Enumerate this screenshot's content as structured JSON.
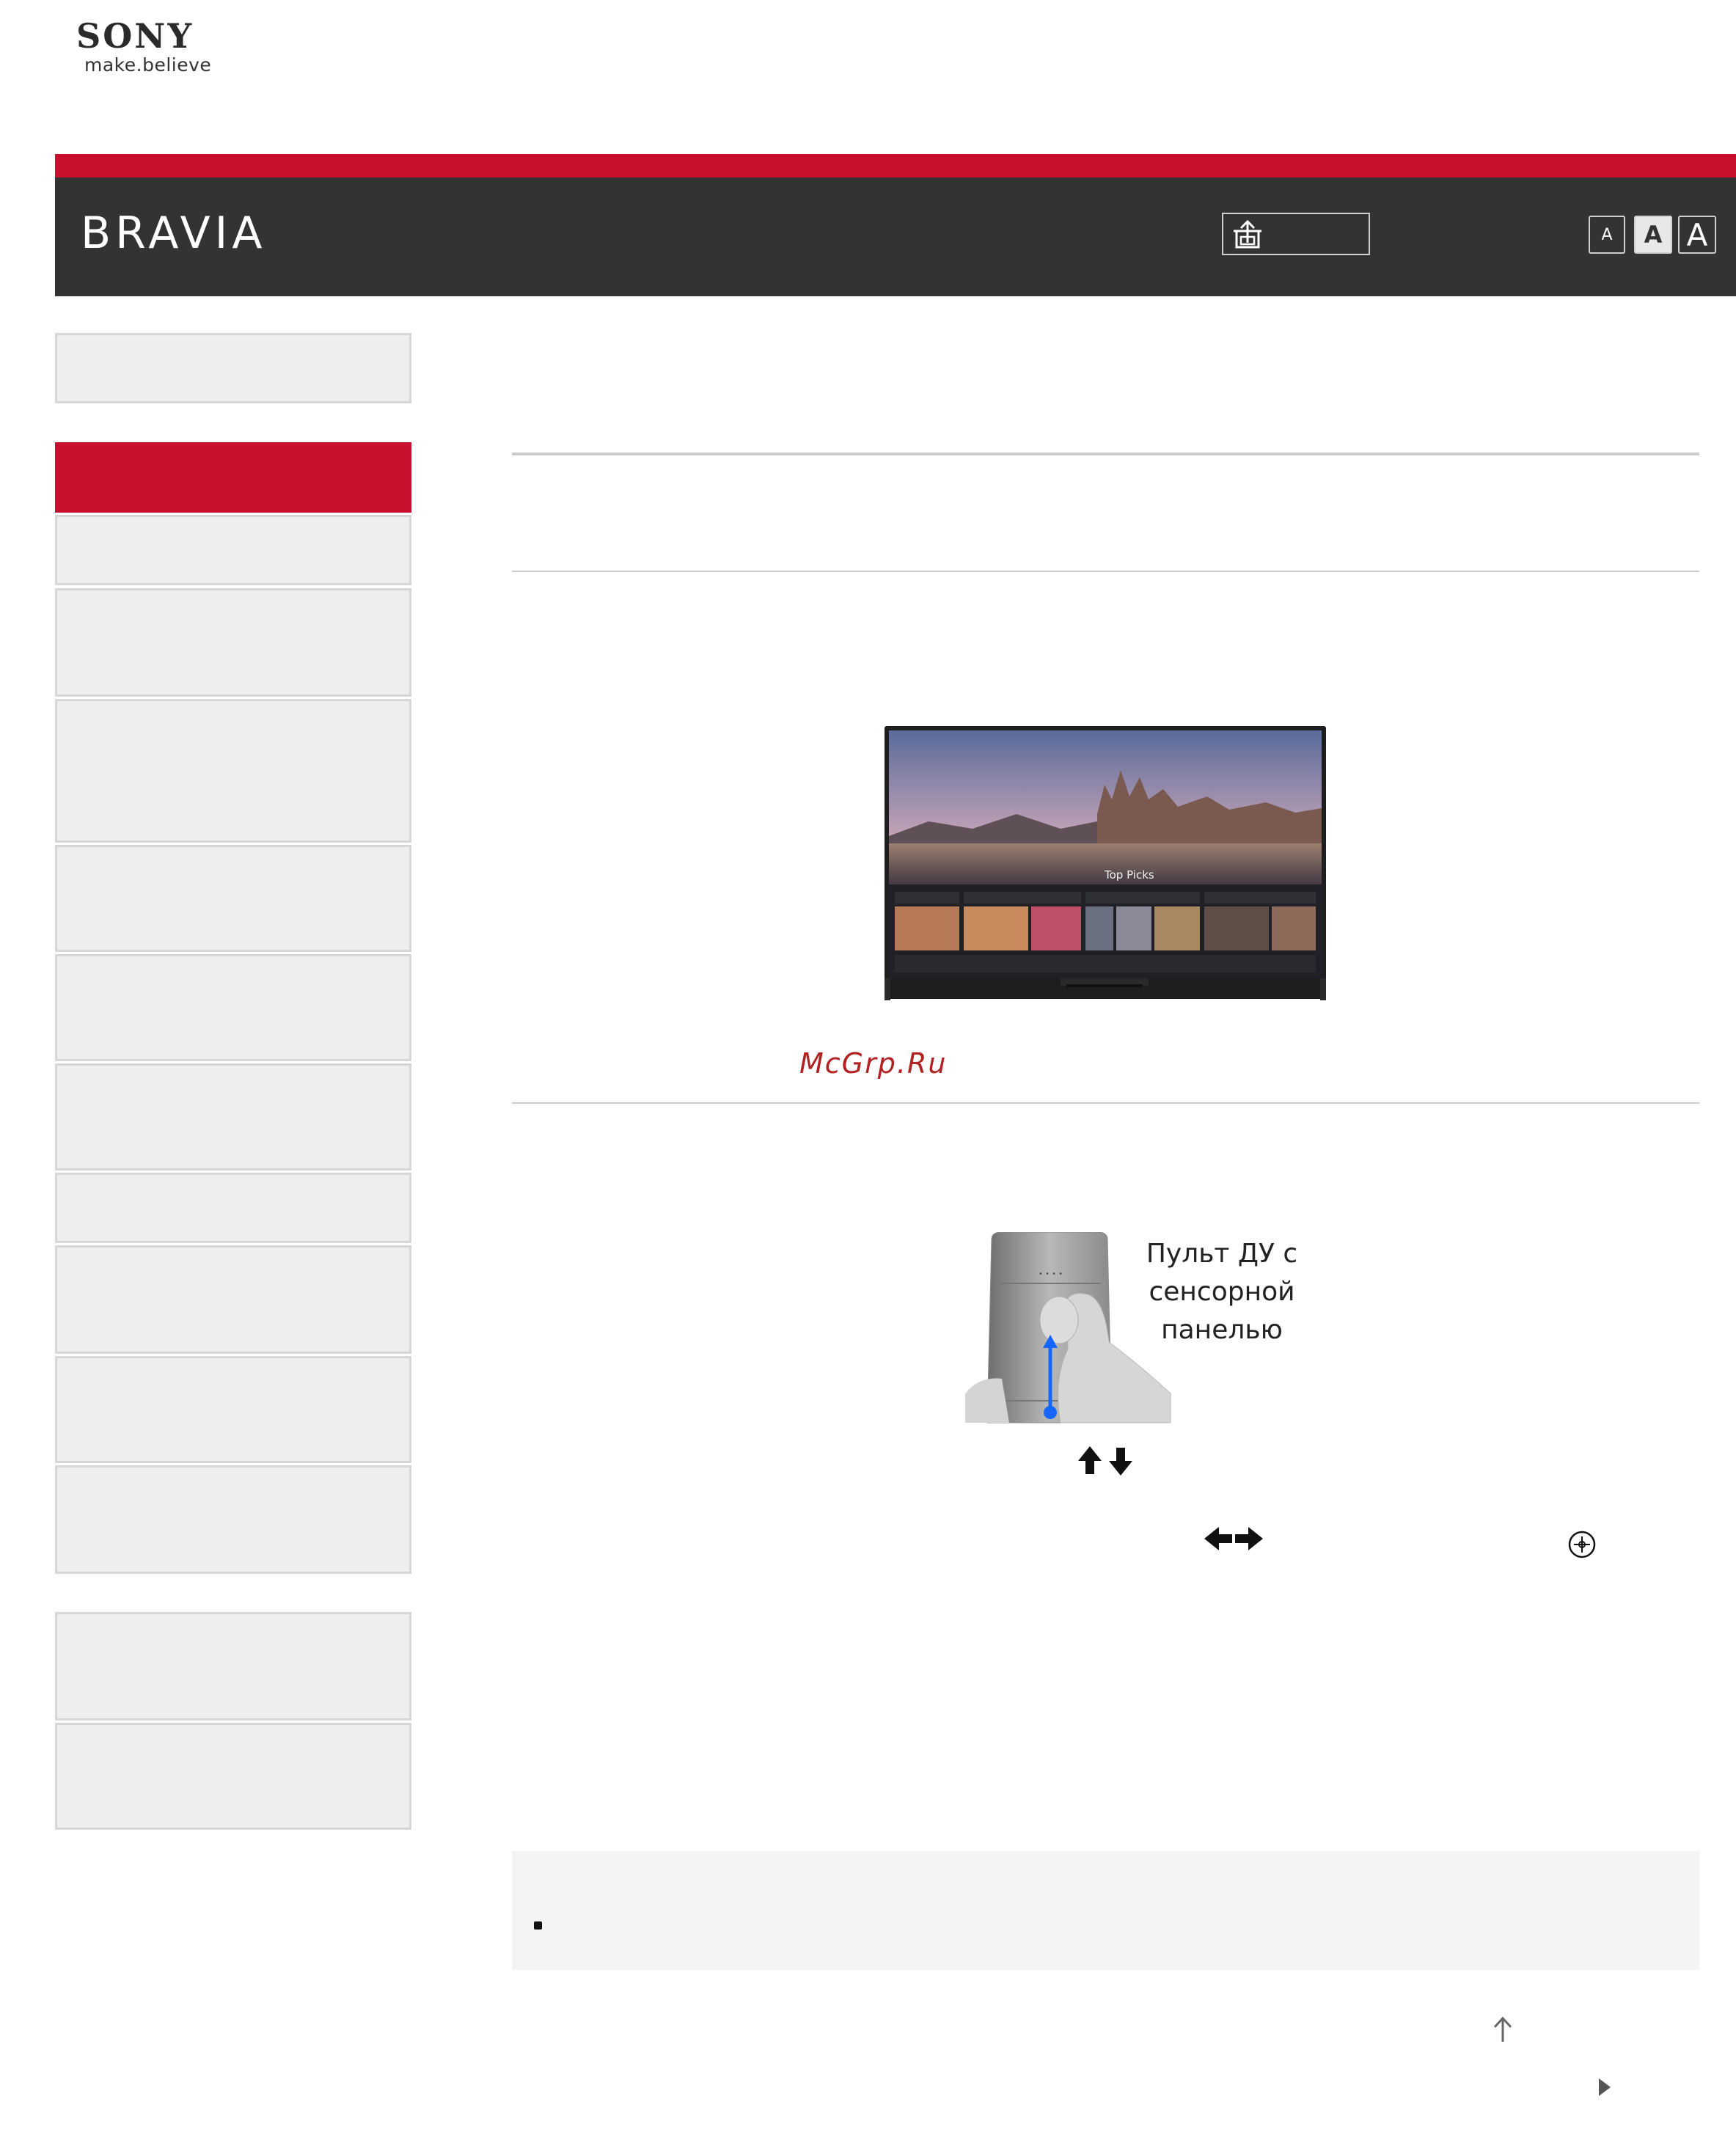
{
  "brand": {
    "name": "SONY",
    "tagline": "make.believe"
  },
  "header": {
    "title": "BRAVIA",
    "font_size_buttons": [
      "A",
      "A",
      "A"
    ]
  },
  "colors": {
    "brand_red": "#c8102e",
    "header_bg": "#333333",
    "nav_bg": "#eeeeee",
    "note_bg": "#f4f4f4",
    "arrow_blue": "#1565ff"
  },
  "icons": {
    "print": "print-icon",
    "up_down": "arrow-up-down-icon",
    "left_right": "arrow-left-right-icon",
    "enter": "enter-circle-icon",
    "page_top": "arrow-up-icon",
    "next": "triangle-right-icon"
  },
  "figure_tv": {
    "screen_label": "Top Picks"
  },
  "watermark": "McGrp.Ru",
  "figure_remote": {
    "caption": "Пульт ДУ с\nсенсорной\nпанелью"
  }
}
